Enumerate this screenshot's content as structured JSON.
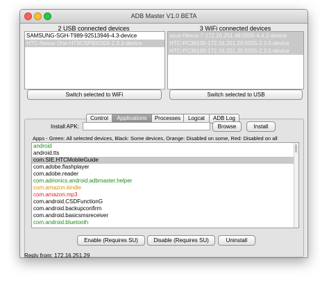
{
  "window": {
    "title": "ADB Master V1.0 BETA"
  },
  "usb": {
    "header": "2 USB connected devices",
    "devices": [
      "SAMSUNG-SGH-T989-92513946-4.3-device",
      "HTC-Nexus One-HT9CSP800326-2.3.3-device"
    ],
    "switch_label": "Switch selected to WiFi"
  },
  "wifi": {
    "header": "3 WiFi connected devices",
    "devices": [
      "asus-Nexus 7-172.16.251.48:5555-4.4.2-device",
      "HTC-PC36100-172.16.251.29:5555-2.3.5-device",
      "HTC-PC36100-172.16.251.35:5555-2.3.5-device"
    ],
    "switch_label": "Switch selected to USB"
  },
  "tabs": [
    "Control",
    "Applications",
    "Processes",
    "Logcat",
    "ADB Log"
  ],
  "active_tab": "Applications",
  "install": {
    "label": "Install APK:",
    "value": "",
    "browse_label": "Browse",
    "install_label": "Install"
  },
  "apps": {
    "legend": "Apps - Green: All selected devices, Black: Some devices, Orange: Disabled on some, Red: Disabled on all",
    "items": [
      {
        "name": "android",
        "color": "#1a8c1a"
      },
      {
        "name": "android.tts",
        "color": "#000000"
      },
      {
        "name": "com.SIE.HTCMobileGuide",
        "color": "#000000"
      },
      {
        "name": "com.adobe.flashplayer",
        "color": "#000000"
      },
      {
        "name": "com.adobe.reader",
        "color": "#000000"
      },
      {
        "name": "com.adrionics.android.adbmaster.helper",
        "color": "#1a8c1a"
      },
      {
        "name": "com.amazon.kindle",
        "color": "#e08a00"
      },
      {
        "name": "com.amazon.mp3",
        "color": "#e02020"
      },
      {
        "name": "com.android.CSDFunctionG",
        "color": "#000000"
      },
      {
        "name": "com.android.backupconfirm",
        "color": "#000000"
      },
      {
        "name": "com.android.basicsmsreceiver",
        "color": "#000000"
      },
      {
        "name": "com.android.bluetooth",
        "color": "#1a8c1a"
      }
    ],
    "selected_index": 2
  },
  "actions": {
    "enable": "Enable (Requires SU)",
    "disable": "Disable (Requires SU)",
    "uninstall": "Uninstall"
  },
  "status": "Reply from: 172.16.251.29",
  "colors": {
    "light_close": "#ff5f57",
    "light_min": "#ffbd2e",
    "light_max": "#28c840",
    "selection": "#c9c9c9",
    "active_tab": "#999999"
  }
}
